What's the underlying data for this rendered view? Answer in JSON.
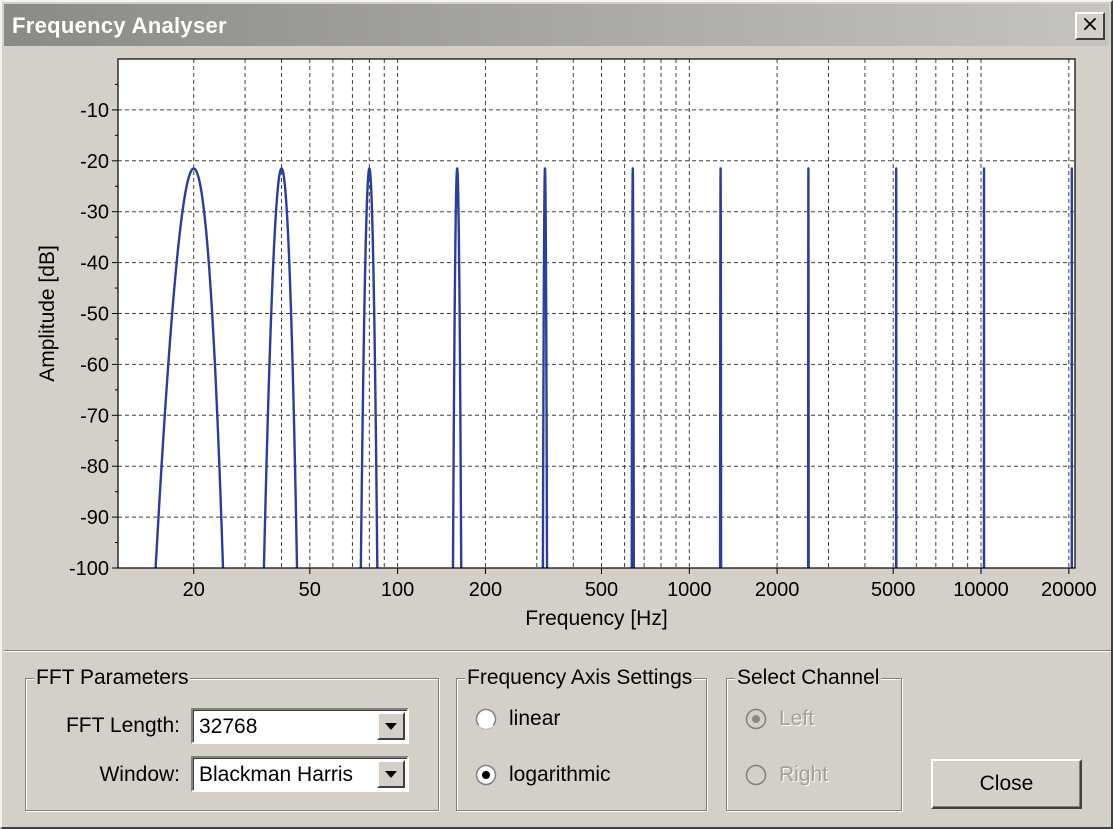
{
  "window": {
    "title": "Frequency Analyser",
    "close_glyph": "×",
    "close_icon": "close-icon"
  },
  "chart_data": {
    "type": "line",
    "xlabel": "Frequency [Hz]",
    "ylabel": "Amplitude [dB]",
    "x_scale": "log",
    "xlim": [
      11,
      21000
    ],
    "ylim": [
      -100,
      0
    ],
    "grid": true,
    "x_tick_labels": [
      {
        "value": 20,
        "label": "20"
      },
      {
        "value": 50,
        "label": "50"
      },
      {
        "value": 100,
        "label": "100"
      },
      {
        "value": 200,
        "label": "200"
      },
      {
        "value": 500,
        "label": "500"
      },
      {
        "value": 1000,
        "label": "1000"
      },
      {
        "value": 2000,
        "label": "2000"
      },
      {
        "value": 5000,
        "label": "5000"
      },
      {
        "value": 10000,
        "label": "10000"
      },
      {
        "value": 20000,
        "label": "20000"
      }
    ],
    "y_ticks": [
      {
        "value": -10,
        "label": "-10"
      },
      {
        "value": -20,
        "label": "-20"
      },
      {
        "value": -30,
        "label": "-30"
      },
      {
        "value": -40,
        "label": "-40"
      },
      {
        "value": -50,
        "label": "-50"
      },
      {
        "value": -60,
        "label": "-60"
      },
      {
        "value": -70,
        "label": "-70"
      },
      {
        "value": -80,
        "label": "-80"
      },
      {
        "value": -90,
        "label": "-90"
      },
      {
        "value": -100,
        "label": "-100"
      }
    ],
    "series": [
      {
        "color": "#2b3f9a",
        "peaks": [
          {
            "frequency": 20,
            "amplitude": -21.5,
            "half_width_hz": 5.2
          },
          {
            "frequency": 40,
            "amplitude": -21.5,
            "half_width_hz": 5.2
          },
          {
            "frequency": 80,
            "amplitude": -21.5,
            "half_width_hz": 5.2
          },
          {
            "frequency": 160,
            "amplitude": -21.5,
            "half_width_hz": 5.2
          },
          {
            "frequency": 320,
            "amplitude": -21.5,
            "half_width_hz": 5.2
          },
          {
            "frequency": 640,
            "amplitude": -21.5,
            "half_width_hz": 5.2
          },
          {
            "frequency": 1280,
            "amplitude": -21.5,
            "half_width_hz": 5.2
          },
          {
            "frequency": 2560,
            "amplitude": -21.5,
            "half_width_hz": 5.2
          },
          {
            "frequency": 5120,
            "amplitude": -21.5,
            "half_width_hz": 5.2
          },
          {
            "frequency": 10240,
            "amplitude": -21.5,
            "half_width_hz": 5.2
          },
          {
            "frequency": 20480,
            "amplitude": -21.5,
            "half_width_hz": 5.2
          }
        ]
      }
    ]
  },
  "fft_parameters": {
    "legend": "FFT Parameters",
    "length_label": "FFT Length:",
    "length_value": "32768",
    "window_label": "Window:",
    "window_value": "Blackman Harris",
    "dropdown_icon": "chevron-down-icon"
  },
  "frequency_axis": {
    "legend": "Frequency Axis Settings",
    "options": [
      {
        "label": "linear",
        "selected": false
      },
      {
        "label": "logarithmic",
        "selected": true
      }
    ]
  },
  "select_channel": {
    "legend": "Select Channel",
    "options": [
      {
        "label": "Left",
        "selected": true,
        "disabled": true
      },
      {
        "label": "Right",
        "selected": false,
        "disabled": true
      }
    ]
  },
  "close_button": {
    "label": "Close"
  }
}
